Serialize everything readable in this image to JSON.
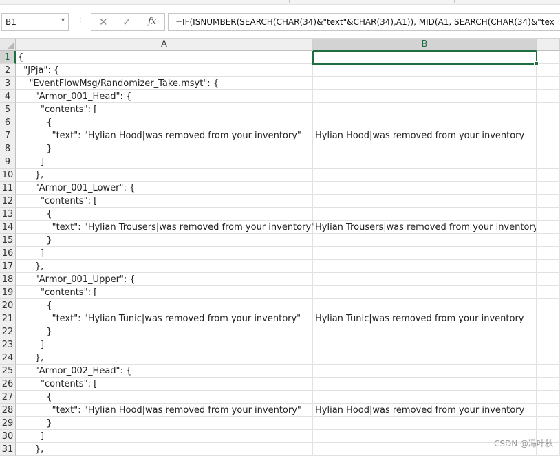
{
  "formula_bar": {
    "name_box": "B1",
    "cancel_glyph": "✕",
    "enter_glyph": "✓",
    "fx_label": "fx",
    "formula": "=IF(ISNUMBER(SEARCH(CHAR(34)&\"text\"&CHAR(34),A1)), MID(A1, SEARCH(CHAR(34)&\"tex"
  },
  "columns": [
    {
      "label": "",
      "selected": false
    },
    {
      "label": "A",
      "selected": false
    },
    {
      "label": "B",
      "selected": true
    }
  ],
  "rows": [
    {
      "n": "1",
      "a": "{",
      "b": ""
    },
    {
      "n": "2",
      "a": "  \"JPja\": {",
      "b": ""
    },
    {
      "n": "3",
      "a": "    \"EventFlowMsg/Randomizer_Take.msyt\": {",
      "b": ""
    },
    {
      "n": "4",
      "a": "      \"Armor_001_Head\": {",
      "b": ""
    },
    {
      "n": "5",
      "a": "        \"contents\": [",
      "b": ""
    },
    {
      "n": "6",
      "a": "          {",
      "b": ""
    },
    {
      "n": "7",
      "a": "            \"text\": \"Hylian Hood|was removed from your inventory\"",
      "b": "Hylian Hood|was removed from your inventory"
    },
    {
      "n": "8",
      "a": "          }",
      "b": ""
    },
    {
      "n": "9",
      "a": "        ]",
      "b": ""
    },
    {
      "n": "10",
      "a": "      },",
      "b": ""
    },
    {
      "n": "11",
      "a": "      \"Armor_001_Lower\": {",
      "b": ""
    },
    {
      "n": "12",
      "a": "        \"contents\": [",
      "b": ""
    },
    {
      "n": "13",
      "a": "          {",
      "b": ""
    },
    {
      "n": "14",
      "a": "            \"text\": \"Hylian Trousers|was removed from your inventory\"",
      "b": "Hylian Trousers|was removed from your inventory"
    },
    {
      "n": "15",
      "a": "          }",
      "b": ""
    },
    {
      "n": "16",
      "a": "        ]",
      "b": ""
    },
    {
      "n": "17",
      "a": "      },",
      "b": ""
    },
    {
      "n": "18",
      "a": "      \"Armor_001_Upper\": {",
      "b": ""
    },
    {
      "n": "19",
      "a": "        \"contents\": [",
      "b": ""
    },
    {
      "n": "20",
      "a": "          {",
      "b": ""
    },
    {
      "n": "21",
      "a": "            \"text\": \"Hylian Tunic|was removed from your inventory\"",
      "b": "Hylian Tunic|was removed from your inventory"
    },
    {
      "n": "22",
      "a": "          }",
      "b": ""
    },
    {
      "n": "23",
      "a": "        ]",
      "b": ""
    },
    {
      "n": "24",
      "a": "      },",
      "b": ""
    },
    {
      "n": "25",
      "a": "      \"Armor_002_Head\": {",
      "b": ""
    },
    {
      "n": "26",
      "a": "        \"contents\": [",
      "b": ""
    },
    {
      "n": "27",
      "a": "          {",
      "b": ""
    },
    {
      "n": "28",
      "a": "            \"text\": \"Hylian Hood|was removed from your inventory\"",
      "b": "Hylian Hood|was removed from your inventory"
    },
    {
      "n": "29",
      "a": "          }",
      "b": ""
    },
    {
      "n": "30",
      "a": "        ]",
      "b": ""
    },
    {
      "n": "31",
      "a": "      },",
      "b": ""
    }
  ],
  "watermark": "CSDN @冯叶秋",
  "colors": {
    "accent_green": "#1e6e42",
    "gridline": "#e1e1e1",
    "header_bg": "#efefef"
  }
}
